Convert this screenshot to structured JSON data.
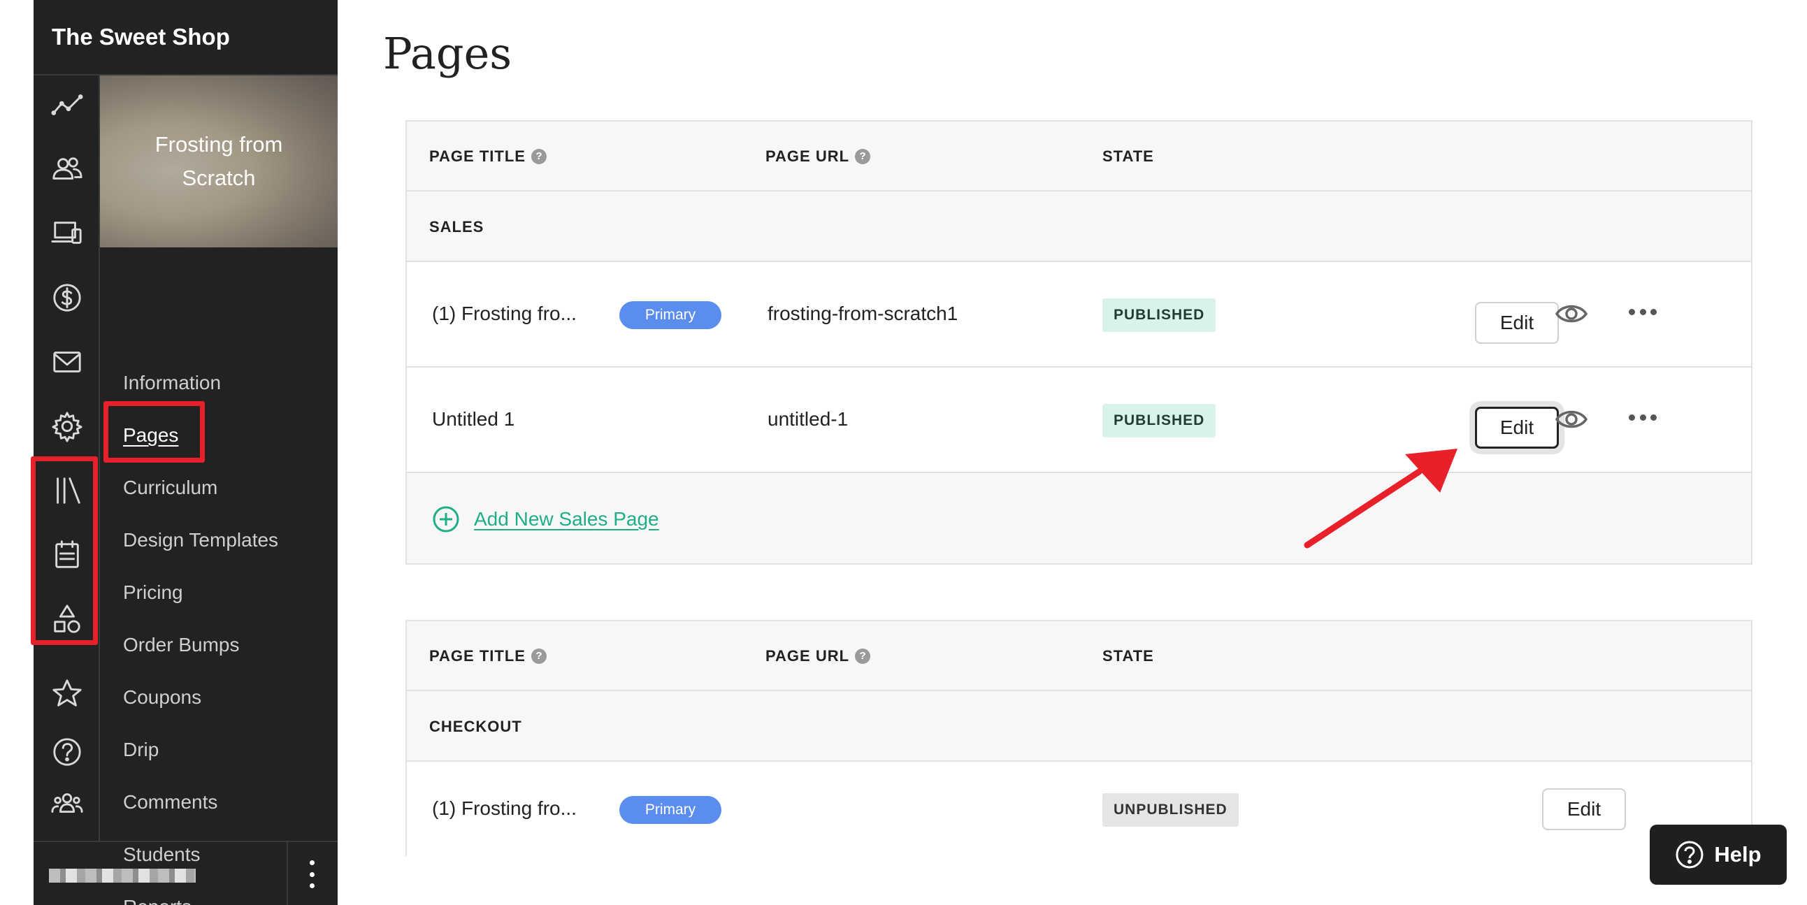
{
  "app": {
    "brand": "The Sweet Shop"
  },
  "colors": {
    "sidebar_bg": "#222222",
    "accent_green": "#1fae86",
    "primary_badge": "#5b8def",
    "highlight_red": "#e8202a"
  },
  "rail_icons": [
    "analytics-icon",
    "users-icon",
    "devices-icon",
    "dollar-icon",
    "mail-icon",
    "gear-icon",
    "library-icon",
    "calendar-icon",
    "shapes-icon",
    "star-icon",
    "question-icon",
    "community-icon"
  ],
  "course": {
    "title": "Frosting from Scratch"
  },
  "nav": {
    "items": [
      {
        "label": "Information"
      },
      {
        "label": "Pages"
      },
      {
        "label": "Curriculum"
      },
      {
        "label": "Design Templates"
      },
      {
        "label": "Pricing"
      },
      {
        "label": "Order Bumps"
      },
      {
        "label": "Coupons"
      },
      {
        "label": "Drip"
      },
      {
        "label": "Comments"
      },
      {
        "label": "Students"
      },
      {
        "label": "Reports"
      }
    ],
    "active": "Pages"
  },
  "main": {
    "title": "Pages",
    "columns": {
      "page_title": "PAGE TITLE",
      "page_url": "PAGE URL",
      "state": "STATE"
    },
    "help_mark": "?",
    "sales": {
      "section_label": "SALES",
      "rows": [
        {
          "title": "(1) Frosting fro...",
          "badge": "Primary",
          "url": "frosting-from-scratch1",
          "state": "PUBLISHED",
          "edit": "Edit"
        },
        {
          "title": "Untitled 1",
          "badge": "",
          "url": "untitled-1",
          "state": "PUBLISHED",
          "edit": "Edit"
        }
      ],
      "add_label": "Add New Sales Page"
    },
    "checkout": {
      "section_label": "CHECKOUT",
      "rows": [
        {
          "title": "(1) Frosting fro...",
          "badge": "Primary",
          "url": "",
          "state": "UNPUBLISHED",
          "edit": "Edit"
        }
      ]
    }
  },
  "help": {
    "label": "Help"
  }
}
